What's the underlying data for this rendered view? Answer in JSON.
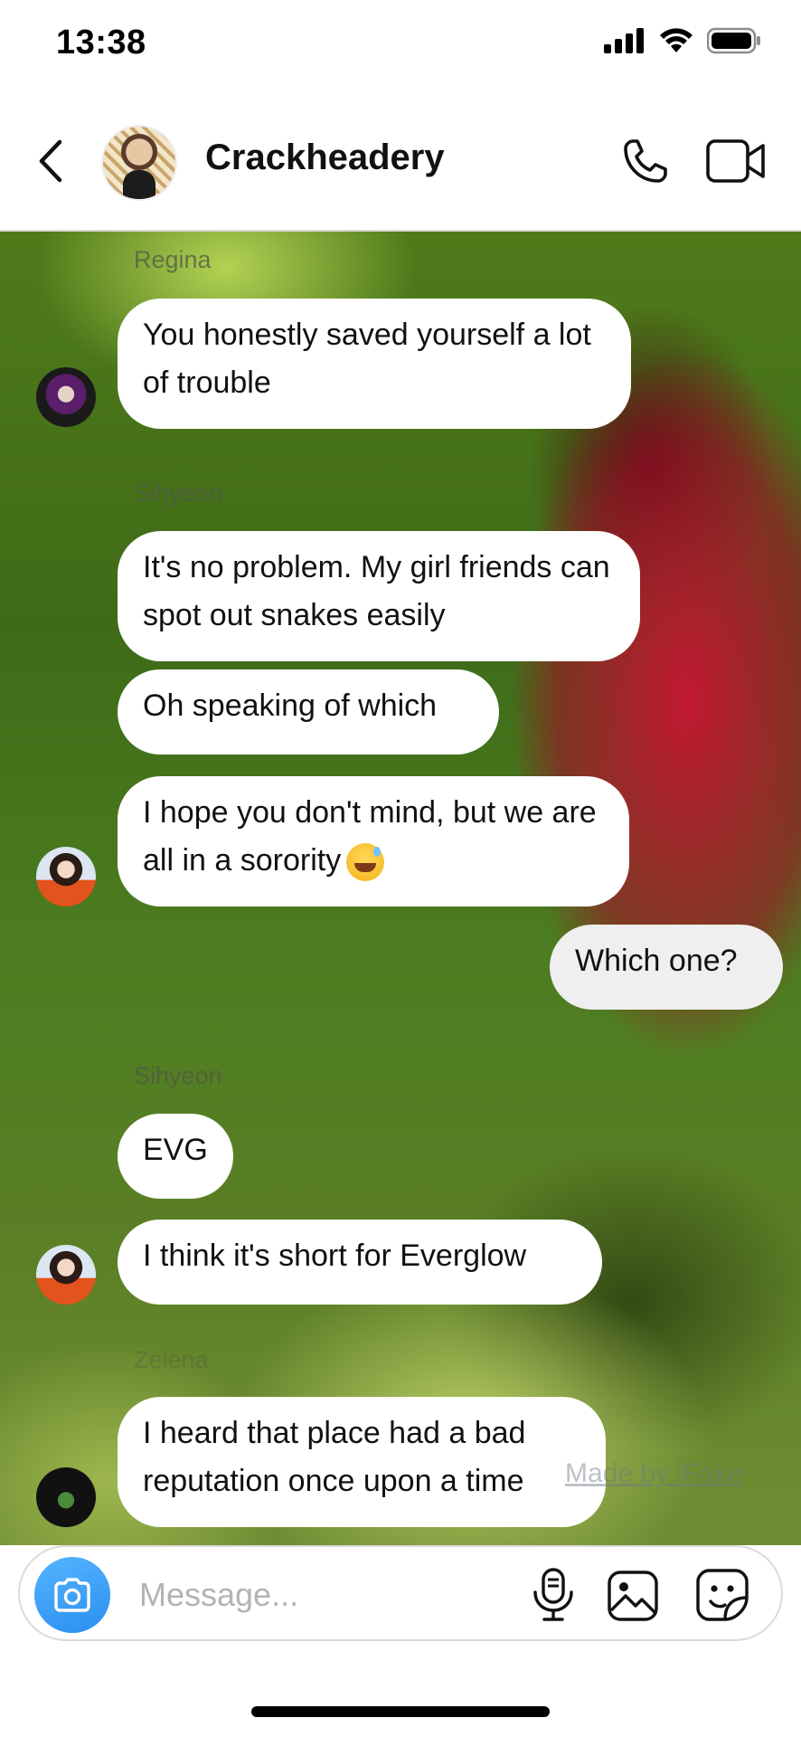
{
  "status_bar": {
    "time": "13:38"
  },
  "header": {
    "title": "Crackheadery"
  },
  "chat": {
    "senders": {
      "regina": "Regina",
      "sihyeon_1": "Sihyeon",
      "sihyeon_2": "Sihyeon",
      "zelena": "Zelena"
    },
    "messages": [
      {
        "text": "You honestly saved yourself a lot of trouble",
        "direction": "incoming"
      },
      {
        "text": "It's no problem. My girl friends can spot out snakes easily",
        "direction": "incoming"
      },
      {
        "text": "Oh speaking of which",
        "direction": "incoming"
      },
      {
        "text": "I hope you don't mind, but we are all in a sorority",
        "direction": "incoming",
        "emoji": "grinning-sweat-emoji"
      },
      {
        "text": "Which one?",
        "direction": "outgoing"
      },
      {
        "text": "EVG",
        "direction": "incoming"
      },
      {
        "text": "I think it's short for Everglow",
        "direction": "incoming"
      },
      {
        "text": "I heard that place had a bad reputation once upon a time",
        "direction": "incoming"
      }
    ],
    "watermark": "Made by iFake"
  },
  "composer": {
    "placeholder": "Message..."
  },
  "icons": {
    "back": "chevron-left-icon",
    "call": "phone-icon",
    "video": "video-camera-icon",
    "camera": "camera-icon",
    "mic": "microphone-icon",
    "gallery": "image-icon",
    "sticker": "sticker-icon"
  },
  "colors": {
    "incoming_bubble": "#ffffff",
    "outgoing_bubble": "#efefef",
    "camera_button": "#3797f0"
  }
}
